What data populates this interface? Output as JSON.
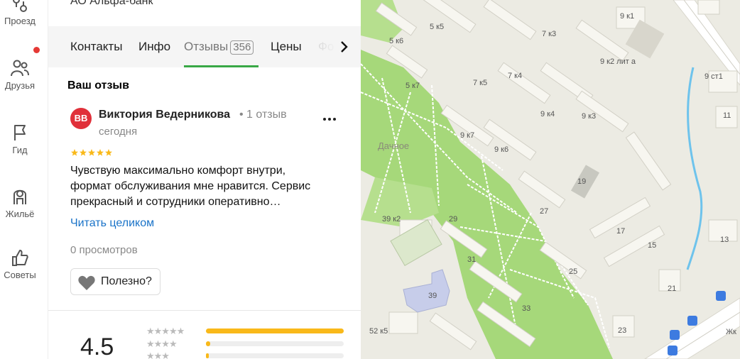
{
  "rail": {
    "items": [
      {
        "label": "Проезд",
        "icon": "route-icon"
      },
      {
        "label": "Друзья",
        "icon": "friends-icon"
      },
      {
        "label": "Гид",
        "icon": "flag-icon"
      },
      {
        "label": "Жильё",
        "icon": "housing-icon"
      },
      {
        "label": "Советы",
        "icon": "thumbs-up-icon"
      }
    ]
  },
  "place": {
    "name": "АО Альфа-банк"
  },
  "tabs": [
    {
      "label": "Контакты"
    },
    {
      "label": "Инфо"
    },
    {
      "label": "Отзывы",
      "count": "356"
    },
    {
      "label": "Цены"
    },
    {
      "label": "Фо"
    }
  ],
  "review": {
    "header": "Ваш отзыв",
    "avatar_initials": "ВВ",
    "author": "Виктория Ведерникова",
    "author_meta": "• 1 отзыв",
    "date": "сегодня",
    "stars": 5,
    "text_line1": "Чувствую максимально комфорт внутри,",
    "text_line2": "формат обслуживания мне нравится. Сервис",
    "text_line3": "прекрасный и сотрудники оперативно…",
    "read_more": "Читать целиком",
    "views": "0 просмотров",
    "helpful": "Полезно?"
  },
  "rating": {
    "value": "4.5",
    "distribution": [
      {
        "stars": 5,
        "fraction": 1.0
      },
      {
        "stars": 4,
        "fraction": 0.03
      },
      {
        "stars": 3,
        "fraction": 0.02
      }
    ]
  },
  "map": {
    "labels": [
      "5 к5",
      "5 к6",
      "5 к7",
      "7 к3",
      "7 к4",
      "7 к5",
      "9 к1",
      "9 к2 лит а",
      "9 ст1",
      "9 к4",
      "9 к3",
      "9 к7",
      "9 к6",
      "Дачное",
      "11",
      "19",
      "27",
      "29",
      "39 к2",
      "31",
      "17",
      "15",
      "13",
      "25",
      "21",
      "39",
      "33",
      "52 к5",
      "23",
      "Жк"
    ],
    "colors": {
      "land": "#ecebe3",
      "park": "#a6d87a",
      "building": "#f7f6f0",
      "road": "#ffffff",
      "water": "#6ec3ec",
      "school": "#c7cdea"
    }
  }
}
